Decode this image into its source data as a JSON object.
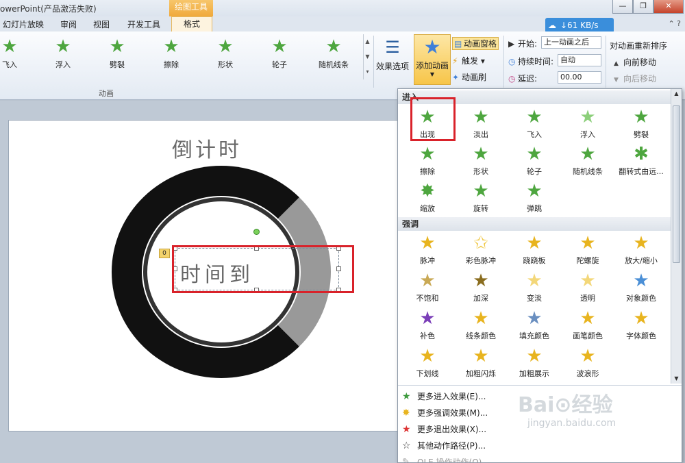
{
  "window": {
    "title": "owerPoint(产品激活失败)",
    "context_tab": "绘图工具",
    "buttons": [
      "—",
      "❐",
      "✕"
    ]
  },
  "tabs": [
    "幻灯片放映",
    "审阅",
    "视图",
    "开发工具",
    "格式"
  ],
  "speed": "↓61 KB/s",
  "gallery": {
    "items": [
      "飞入",
      "浮入",
      "劈裂",
      "擦除",
      "形状",
      "轮子",
      "随机线条"
    ],
    "group_label": "动画",
    "effect_options": "效果选项"
  },
  "add_animation": {
    "label": "添加动画",
    "pane": "动画窗格",
    "trigger": "触发",
    "painter": "动画刷"
  },
  "timing": {
    "start_label": "开始:",
    "start_value": "上一动画之后",
    "duration_label": "持续时间:",
    "duration_value": "自动",
    "delay_label": "延迟:",
    "delay_value": "00.00"
  },
  "reorder": {
    "title": "对动画重新排序",
    "forward": "向前移动",
    "backward": "向后移动"
  },
  "slide": {
    "title": "倒计时",
    "text": "时间到",
    "anim_tag": "0"
  },
  "panel": {
    "section_entrance": "进入",
    "entrance": [
      "出现",
      "淡出",
      "飞入",
      "浮入",
      "劈裂",
      "擦除",
      "形状",
      "轮子",
      "随机线条",
      "翻转式由远...",
      "缩放",
      "旋转",
      "弹跳"
    ],
    "section_emphasis": "强调",
    "emphasis": [
      "脉冲",
      "彩色脉冲",
      "跷跷板",
      "陀螺旋",
      "放大/缩小",
      "不饱和",
      "加深",
      "变淡",
      "透明",
      "对象颜色",
      "补色",
      "线条颜色",
      "填充颜色",
      "画笔颜色",
      "字体颜色",
      "下划线",
      "加粗闪烁",
      "加粗展示",
      "波浪形"
    ],
    "more": [
      "更多进入效果(E)...",
      "更多强调效果(M)...",
      "更多退出效果(X)...",
      "其他动作路径(P)...",
      "OLE 操作动作(O)..."
    ]
  },
  "watermark": {
    "main": "Bai⊙经验",
    "sub": "jingyan.baidu.com"
  }
}
